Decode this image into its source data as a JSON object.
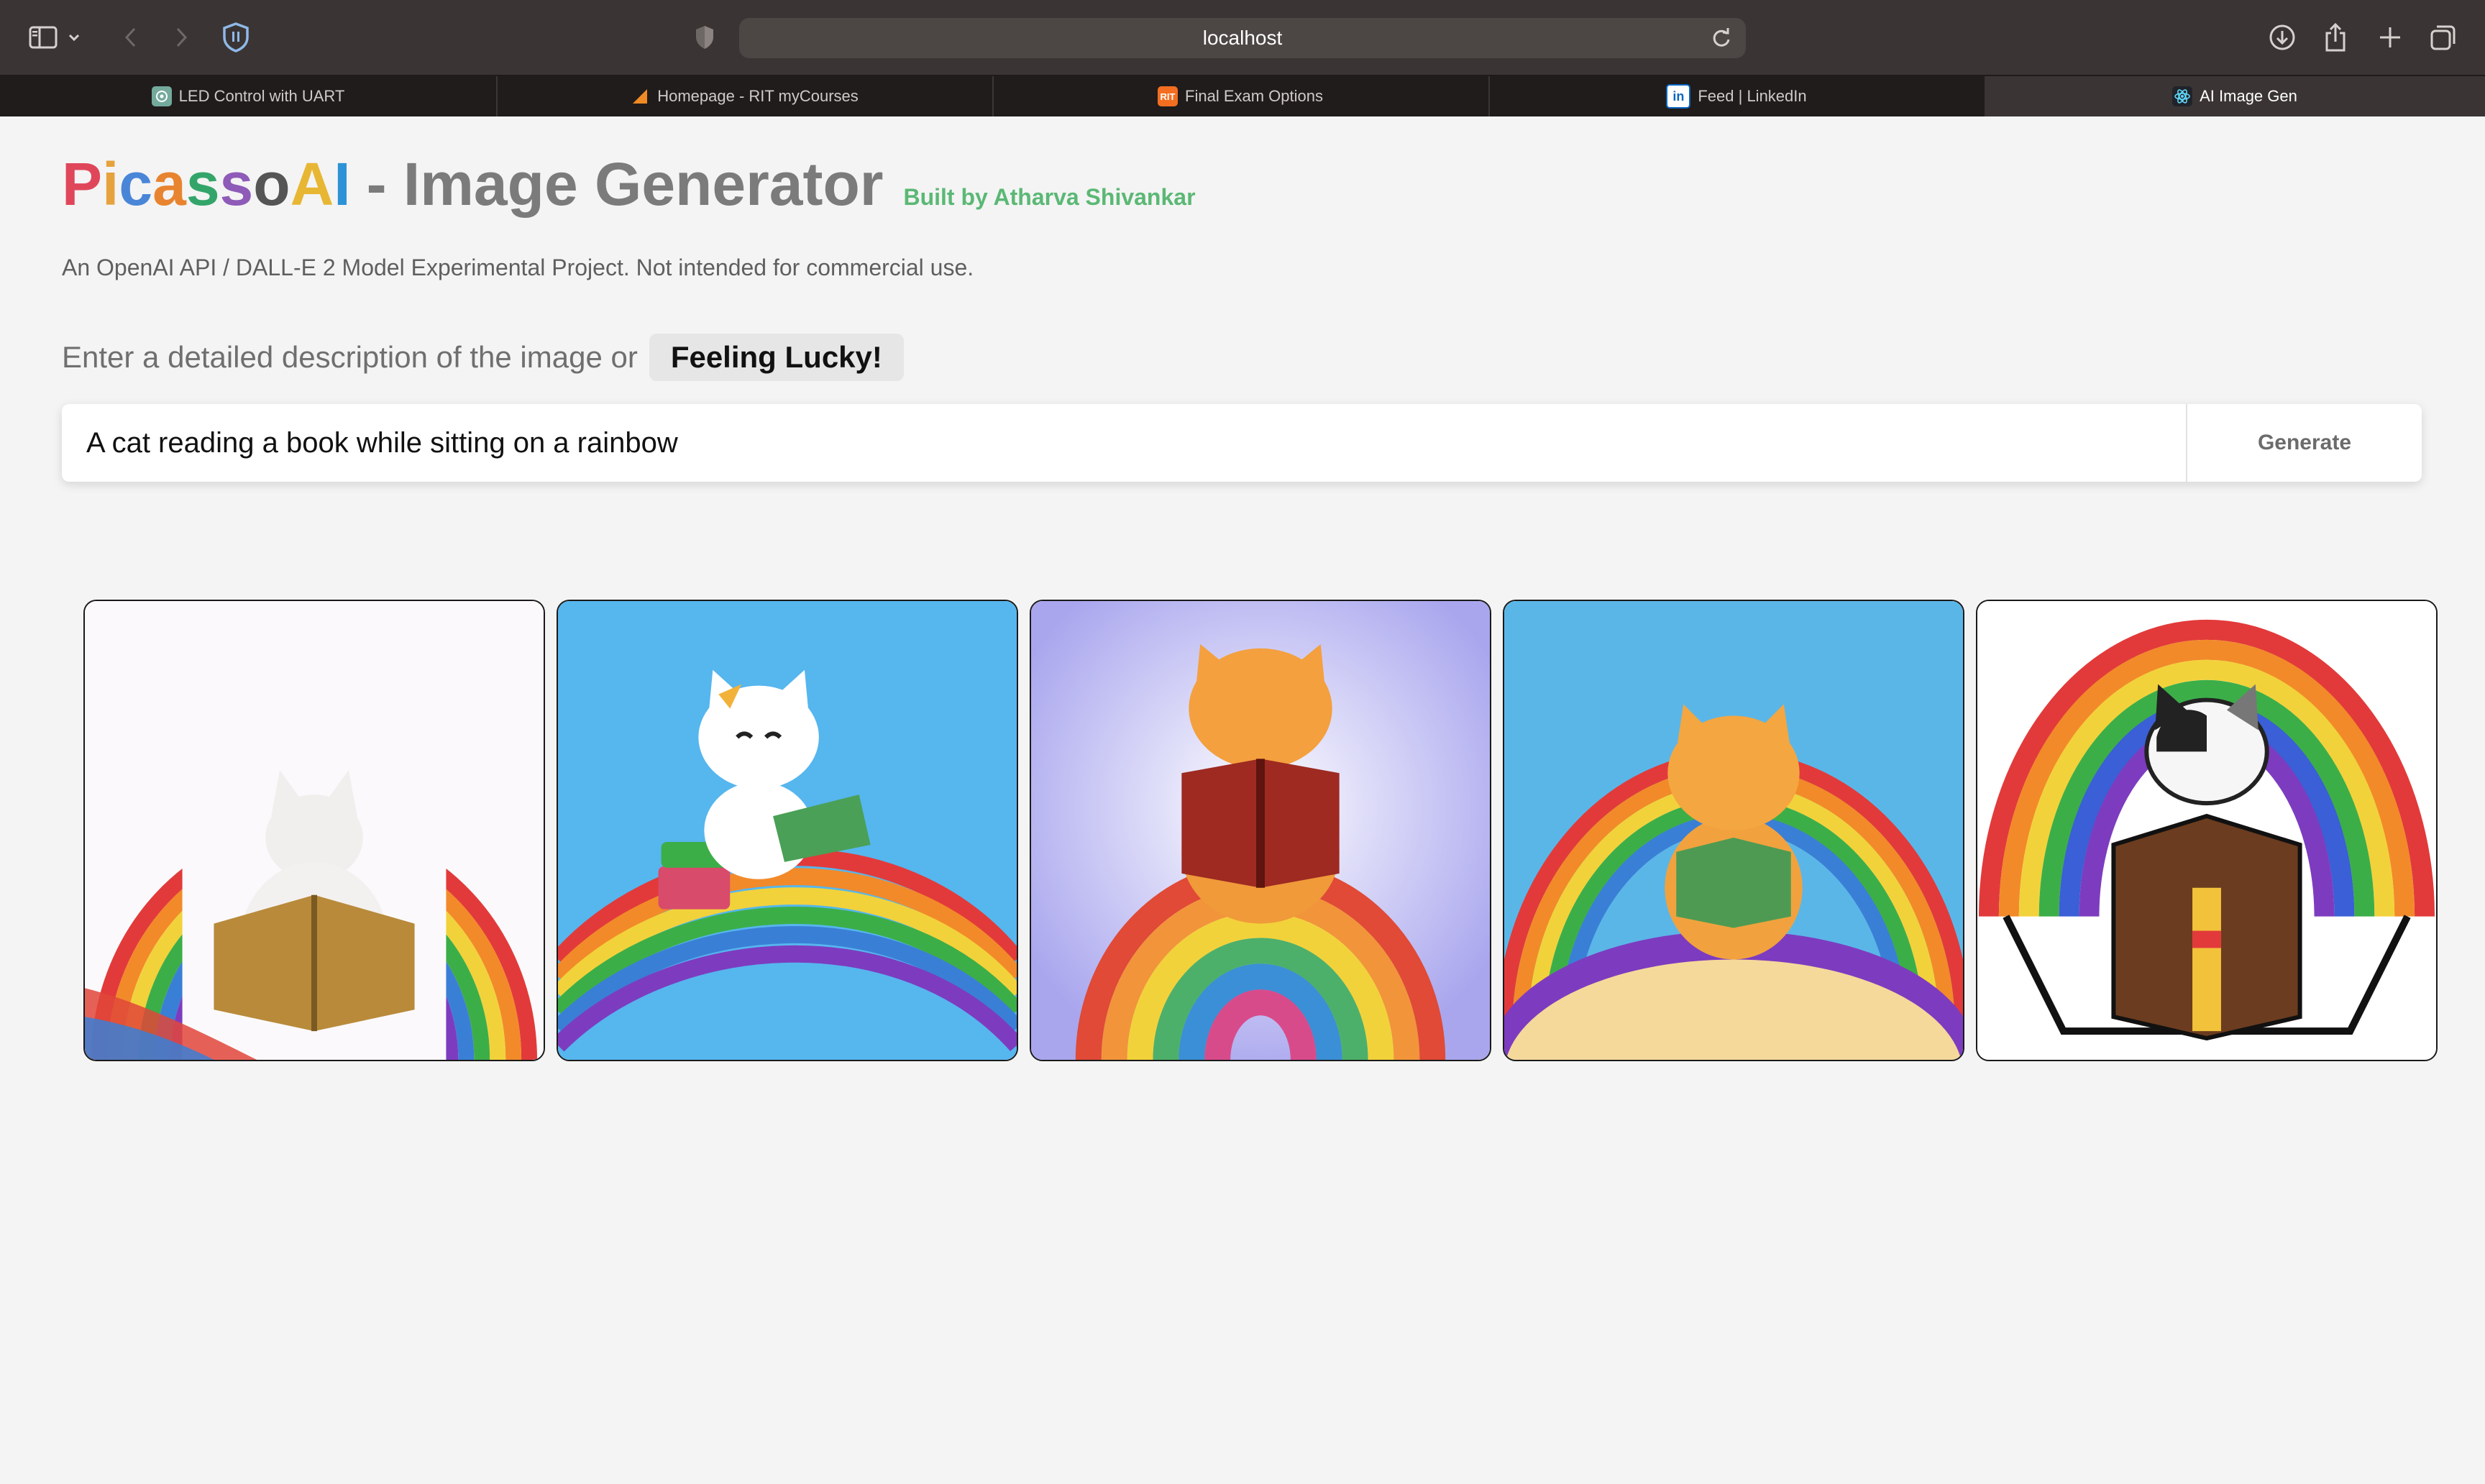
{
  "browser": {
    "url": "localhost",
    "tabs": [
      {
        "label": "LED Control with UART",
        "icon": "chatgpt-icon",
        "active": false
      },
      {
        "label": "Homepage - RIT myCourses",
        "icon": "d2l-icon",
        "active": false
      },
      {
        "label": "Final Exam Options",
        "icon": "rit-icon",
        "active": false
      },
      {
        "label": "Feed | LinkedIn",
        "icon": "linkedin-icon",
        "active": false
      },
      {
        "label": "AI Image Gen",
        "icon": "react-icon",
        "active": true
      }
    ],
    "toolbar_icons": [
      "sidebar-icon",
      "chevron-down-icon",
      "back-icon",
      "forward-icon",
      "privacy-shield-icon",
      "shield-icon",
      "reload-icon",
      "downloads-icon",
      "share-icon",
      "new-tab-icon",
      "tab-overview-icon"
    ]
  },
  "header": {
    "brand": [
      "P",
      "i",
      "c",
      "a",
      "s",
      "s",
      "o",
      "A",
      "I"
    ],
    "brand_colors": [
      "#e0465a",
      "#e6a23c",
      "#4a86d8",
      "#e8842f",
      "#34a56a",
      "#8e5bb8",
      "#555555",
      "#e7b633",
      "#2d92d6"
    ],
    "title_rest": "- Image Generator",
    "byline": "Built by Atharva Shivankar"
  },
  "subtitle": "An OpenAI API / DALL-E 2 Model Experimental Project. Not intended for commercial use.",
  "prompt": {
    "label": "Enter a detailed description of the image or",
    "lucky_button": "Feeling Lucky!"
  },
  "search": {
    "value": "A cat reading a book while sitting on a rainbow",
    "generate_label": "Generate"
  },
  "gallery": {
    "images": [
      {
        "name": "generated-image-1",
        "desc": "white cat reading brown book on rainbow"
      },
      {
        "name": "generated-image-2",
        "desc": "white kitten with bow reading on rainbow"
      },
      {
        "name": "generated-image-3",
        "desc": "orange cat reading red book on rainbow"
      },
      {
        "name": "generated-image-4",
        "desc": "orange cat reading green book under rainbow"
      },
      {
        "name": "generated-image-5",
        "desc": "black and white cat reading giant book"
      }
    ]
  },
  "colors": {
    "page_bg": "#f4f4f4",
    "chrome_bg": "#3a3534",
    "tabbar_bg": "#1f1c1b",
    "byline_green": "#5bb875"
  }
}
